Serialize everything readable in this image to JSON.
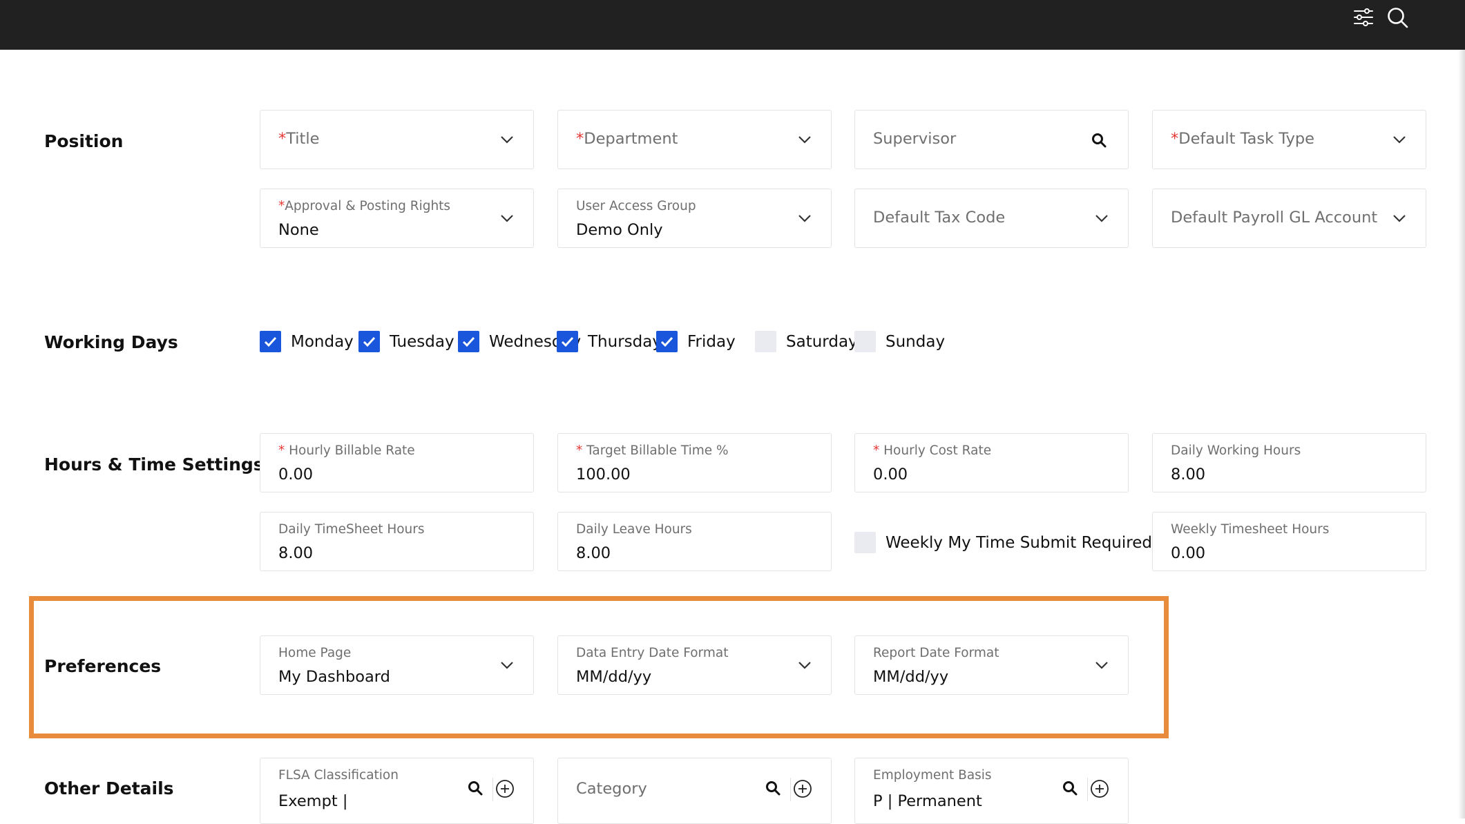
{
  "sections": {
    "position": "Position",
    "working_days": "Working Days",
    "hours": "Hours & Time Settings",
    "preferences": "Preferences",
    "other": "Other Details"
  },
  "required_mark": "*",
  "position": {
    "title": "Title",
    "department": "Department",
    "supervisor": "Supervisor",
    "default_task_type": "Default Task Type",
    "approval_label": "Approval & Posting Rights",
    "approval_value": "None",
    "access_label": "User Access Group",
    "access_value": "Demo Only",
    "tax_code": "Default Tax Code",
    "payroll_gl": "Default Payroll GL Account"
  },
  "working_days": [
    {
      "label": "Monday",
      "checked": true
    },
    {
      "label": "Tuesday",
      "checked": true
    },
    {
      "label": "Wednesday",
      "checked": true
    },
    {
      "label": "Thursday",
      "checked": true
    },
    {
      "label": "Friday",
      "checked": true
    },
    {
      "label": "Saturday",
      "checked": false
    },
    {
      "label": "Sunday",
      "checked": false
    }
  ],
  "hours": {
    "billable_rate_label": "Hourly Billable Rate",
    "billable_rate_value": "0.00",
    "target_label": "Target Billable Time %",
    "target_value": "100.00",
    "cost_rate_label": "Hourly Cost Rate",
    "cost_rate_value": "0.00",
    "daily_working_label": "Daily Working Hours",
    "daily_working_value": "8.00",
    "daily_ts_label": "Daily TimeSheet Hours",
    "daily_ts_value": "8.00",
    "daily_leave_label": "Daily Leave Hours",
    "daily_leave_value": "8.00",
    "weekly_submit_label": "Weekly My Time Submit Required",
    "weekly_submit_checked": false,
    "weekly_ts_label": "Weekly Timesheet Hours",
    "weekly_ts_value": "0.00"
  },
  "preferences": {
    "home_label": "Home Page",
    "home_value": "My Dashboard",
    "entry_label": "Data Entry Date Format",
    "entry_value": "MM/dd/yy",
    "report_label": "Report Date Format",
    "report_value": "MM/dd/yy"
  },
  "other": {
    "flsa_label": "FLSA Classification",
    "flsa_value": "Exempt |",
    "category": "Category",
    "basis_label": "Employment Basis",
    "basis_value": "P | Permanent"
  },
  "colors": {
    "topbar": "#212121",
    "checkbox_on": "#1a56db",
    "highlight": "#e88b3a",
    "required": "#e53935"
  },
  "icons": [
    "filter-sliders-icon",
    "search-icon",
    "chevron-down-icon",
    "magnifier-icon",
    "plus-circle-icon",
    "check-icon"
  ]
}
